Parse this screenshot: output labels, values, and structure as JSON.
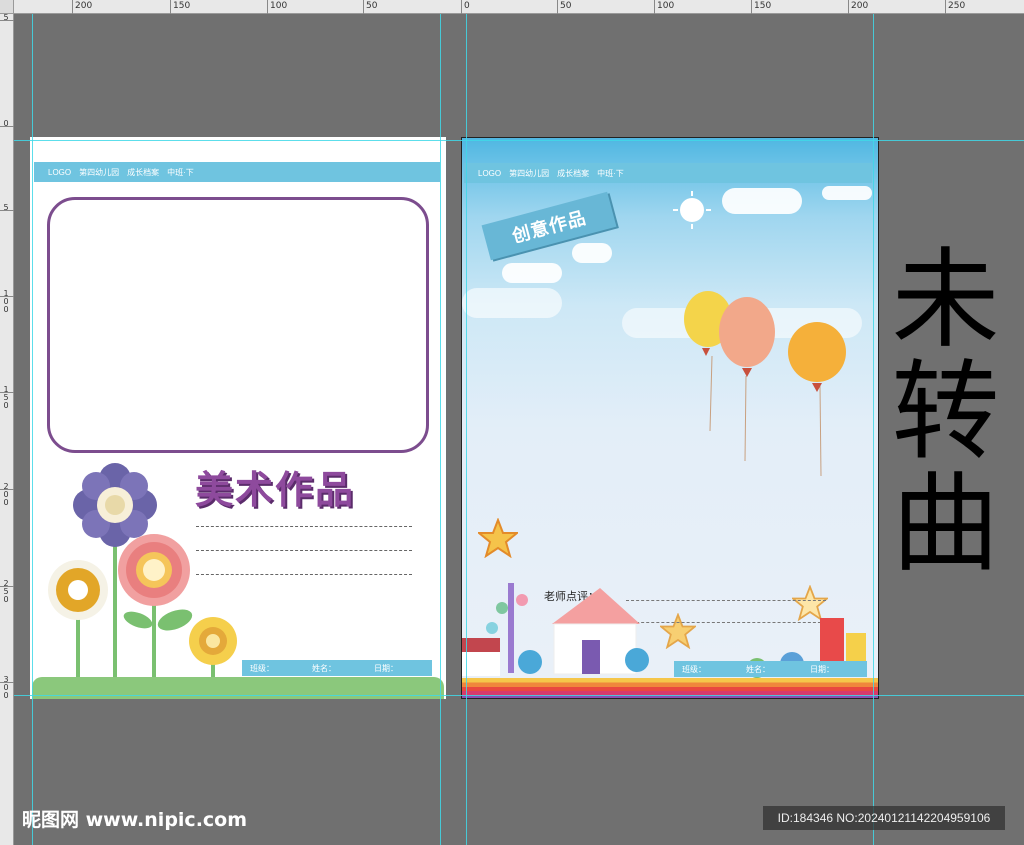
{
  "ruler": {
    "top_labels": [
      "200",
      "150",
      "100",
      "50",
      "0",
      "50",
      "100",
      "150",
      "200",
      "250"
    ],
    "left_labels": [
      "5",
      "0",
      "5",
      "1 0 0",
      "1 5 0",
      "2 0 0",
      "2 5 0",
      "3 0 0"
    ]
  },
  "left_page": {
    "header": {
      "logo": "LOGO",
      "school": "第四幼儿园",
      "archive": "成长档案",
      "term": "中班·下"
    },
    "title": "美术作品",
    "info": {
      "class_label": "班级：",
      "name_label": "姓名：",
      "date_label": "日期："
    }
  },
  "right_page": {
    "header": {
      "logo": "LOGO",
      "school": "第四幼儿园",
      "archive": "成长档案",
      "term": "中班·下"
    },
    "badge": "创意作品",
    "teacher_comment_label": "老师点评：",
    "info": {
      "class_label": "班级：",
      "name_label": "姓名：",
      "date_label": "日期："
    }
  },
  "side_text": [
    "未",
    "转",
    "曲"
  ],
  "watermark": {
    "site": "昵图网 www.nipic.com",
    "id": "ID:184346 NO:20240121142204959106"
  },
  "colors": {
    "canvas": "#707070",
    "guide": "#3fd8e8",
    "header_blue": "#6fc4e0",
    "frame_purple": "#7c4d8e",
    "title_purple": "#8e4a9d"
  }
}
